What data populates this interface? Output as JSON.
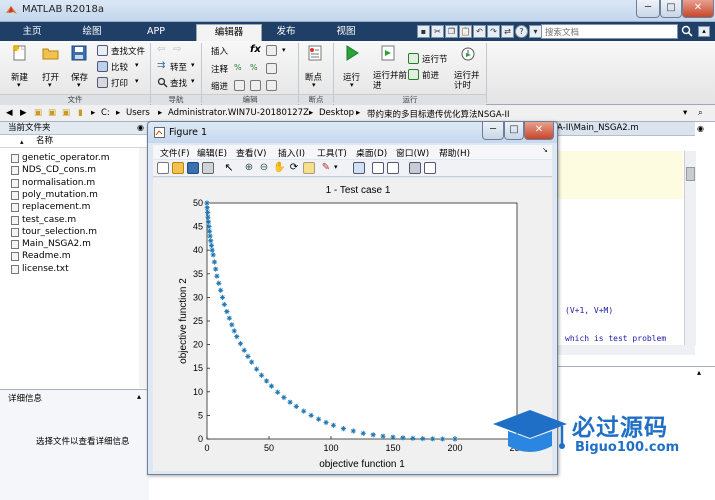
{
  "window": {
    "title": "MATLAB R2018a"
  },
  "tabs": [
    {
      "label": "主页"
    },
    {
      "label": "绘图"
    },
    {
      "label": "APP"
    },
    {
      "label": "编辑器"
    },
    {
      "label": "发布"
    },
    {
      "label": "视图"
    }
  ],
  "search": {
    "placeholder": "搜索文档"
  },
  "ribbon": {
    "file": {
      "new": "新建",
      "open": "打开",
      "save": "保存",
      "find_files": "查找文件",
      "compare": "比较",
      "print": "打印",
      "section": "文件"
    },
    "navigate": {
      "goto": "转至",
      "find": "查找",
      "section": "导航"
    },
    "edit": {
      "insert": "插入",
      "comment": "注释",
      "indent": "缩进",
      "fx": "fx",
      "section": "编辑"
    },
    "breakpoints": {
      "label": "断点",
      "section": "断点"
    },
    "run": {
      "run": "运行",
      "run_advance": "运行并前进",
      "run_section": "运行节",
      "advance": "前进",
      "run_time": "运行并计时",
      "section": "运行"
    }
  },
  "address": {
    "parts": [
      "C:",
      "Users",
      "Administrator.WIN7U-20180127Z",
      "Desktop",
      "带约束的多目标遗传优化算法NSGA-II"
    ]
  },
  "left_panel": {
    "title": "当前文件夹",
    "column": "名称",
    "files": [
      "genetic_operator.m",
      "NDS_CD_cons.m",
      "normalisation.m",
      "poly_mutation.m",
      "replacement.m",
      "test_case.m",
      "tour_selection.m",
      "Main_NSGA2.m",
      "Readme.m",
      "license.txt"
    ]
  },
  "details": {
    "title": "详细信息",
    "hint": "选择文件以查看详细信息"
  },
  "editor": {
    "tab": "A-II\\Main_NSGA2.m",
    "code": [
      "(V+1, V+M)",
      "which is test problem"
    ]
  },
  "figure": {
    "title": "Figure 1",
    "menus": [
      "文件(F)",
      "编辑(E)",
      "查看(V)",
      "插入(I)",
      "工具(T)",
      "桌面(D)",
      "窗口(W)",
      "帮助(H)"
    ]
  },
  "chart_data": {
    "type": "scatter",
    "title": "1 - Test case 1",
    "xlabel": "objective function 1",
    "ylabel": "objective function 2",
    "xlim": [
      0,
      250
    ],
    "ylim": [
      0,
      50
    ],
    "xticks": [
      0,
      50,
      100,
      150,
      200,
      250
    ],
    "yticks": [
      0,
      5,
      10,
      15,
      20,
      25,
      30,
      35,
      40,
      45,
      50
    ],
    "marker": "*",
    "color": "#1f77b4",
    "grid": false,
    "series": [
      {
        "x": [
          0.0,
          0.2,
          0.5,
          0.8,
          1.2,
          1.6,
          2.0,
          2.5,
          3.0,
          3.6,
          4.2,
          5.0,
          6.0,
          7.0,
          8.0,
          9.5,
          11.0,
          12.5,
          14.0,
          16.0,
          18.0,
          20.0,
          22.0,
          24.0,
          27.0,
          30.0,
          33.0,
          36.0,
          40.0,
          44.0,
          48.0,
          52.0,
          57.0,
          62.0,
          67.0,
          72.0,
          78.0,
          84.0,
          90.0,
          96.0,
          102.0,
          110.0,
          118.0,
          126.0,
          134.0,
          142.0,
          150.0,
          158.0,
          166.0,
          174.0,
          182.0,
          190.0,
          200.0
        ],
        "y": [
          50.0,
          49.0,
          48.0,
          47.0,
          46.0,
          45.0,
          44.0,
          43.0,
          42.0,
          41.0,
          40.0,
          39.0,
          37.5,
          36.0,
          34.5,
          33.0,
          31.5,
          30.0,
          28.5,
          27.0,
          25.6,
          24.2,
          22.9,
          21.7,
          20.2,
          18.8,
          17.5,
          16.3,
          14.8,
          13.5,
          12.3,
          11.2,
          9.9,
          8.8,
          7.8,
          6.9,
          5.9,
          5.0,
          4.2,
          3.5,
          2.9,
          2.2,
          1.7,
          1.2,
          0.9,
          0.6,
          0.4,
          0.25,
          0.15,
          0.08,
          0.04,
          0.01,
          0.0
        ]
      }
    ]
  },
  "watermark": {
    "text": "必过源码",
    "sub": "Biguo100.com"
  }
}
